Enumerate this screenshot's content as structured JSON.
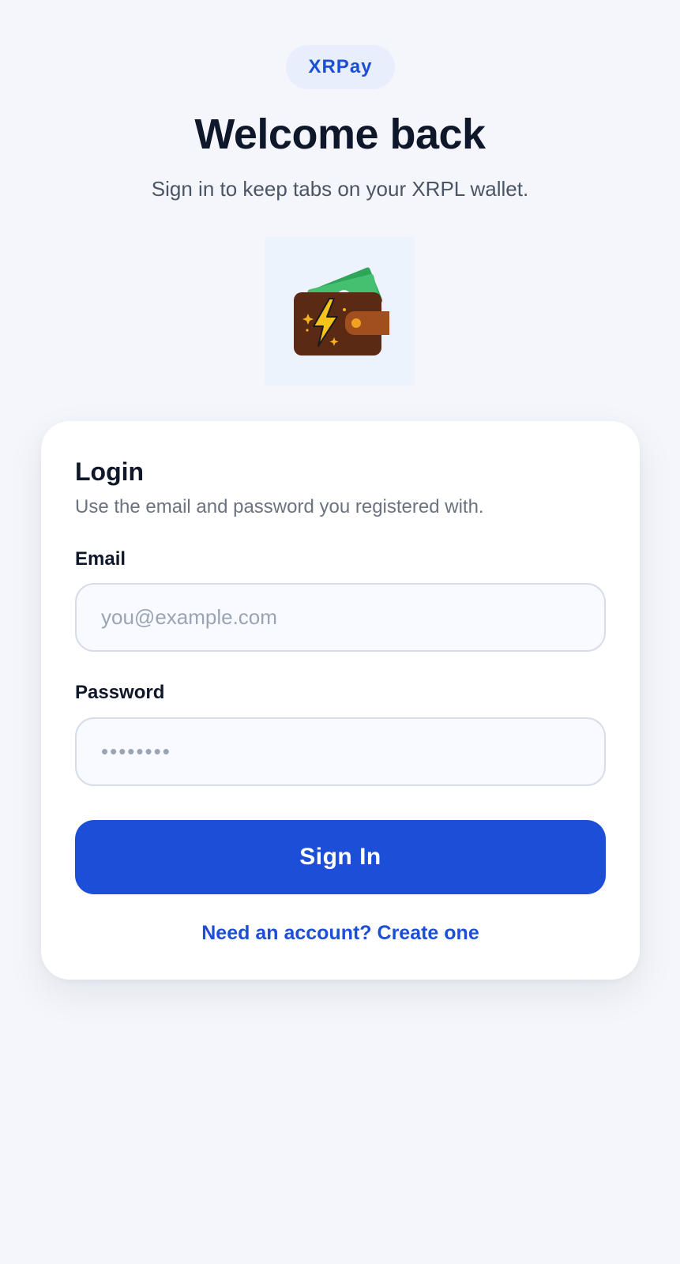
{
  "brand": {
    "name": "XRPay"
  },
  "header": {
    "title": "Welcome back",
    "subtitle": "Sign in to keep tabs on your XRPL wallet."
  },
  "hero": {
    "icon": "wallet-lightning-icon"
  },
  "login": {
    "title": "Login",
    "subtitle": "Use the email and password you registered with.",
    "email": {
      "label": "Email",
      "placeholder": "you@example.com",
      "value": ""
    },
    "password": {
      "label": "Password",
      "placeholder": "••••••••",
      "value": ""
    },
    "submit_label": "Sign In",
    "signup_link": "Need an account? Create one"
  },
  "colors": {
    "accent": "#1d4ed8",
    "background": "#f4f6fb",
    "card": "#ffffff",
    "heading": "#0f172a"
  }
}
